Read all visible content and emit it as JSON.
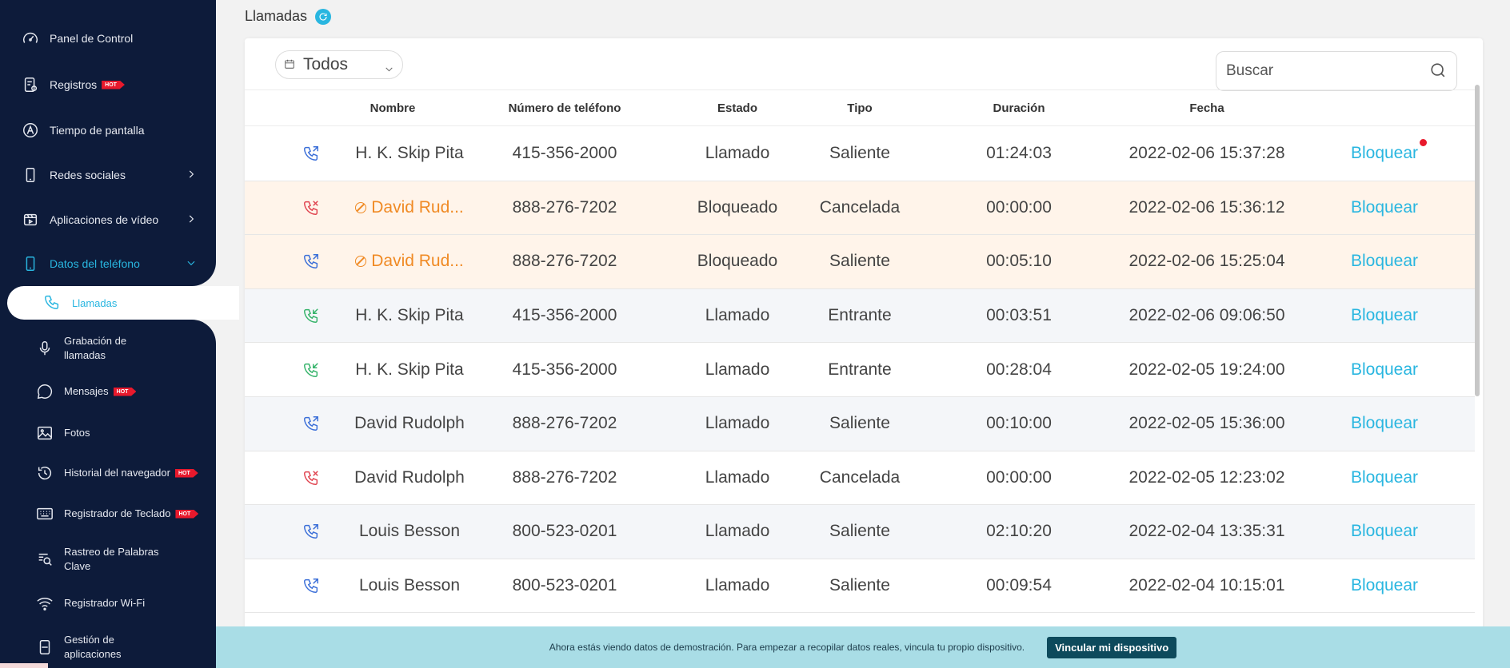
{
  "page": {
    "title": "Llamadas",
    "filter_value": "Todos",
    "search_placeholder": "Buscar"
  },
  "sidebar": {
    "hot_label": "HOT",
    "items": [
      {
        "label": "Panel de Control",
        "icon": "dashboard-icon"
      },
      {
        "label": "Registros",
        "icon": "records-icon",
        "hot": true
      },
      {
        "label": "Tiempo de pantalla",
        "icon": "screen-time-icon"
      },
      {
        "label": "Redes sociales",
        "icon": "phone-icon",
        "chevron": "right"
      },
      {
        "label": "Aplicaciones de vídeo",
        "icon": "video-icon",
        "chevron": "right"
      },
      {
        "label": "Datos del teléfono",
        "icon": "phone-icon",
        "chevron": "down",
        "active": true
      }
    ],
    "sub_items": [
      {
        "label": "Llamadas",
        "icon": "phone-call-icon",
        "active": true
      },
      {
        "label": "Grabación de llamadas",
        "icon": "microphone-icon"
      },
      {
        "label": "Mensajes",
        "icon": "chat-icon",
        "hot": true
      },
      {
        "label": "Fotos",
        "icon": "image-icon"
      },
      {
        "label": "Historial del navegador",
        "icon": "history-icon",
        "hot": true
      },
      {
        "label": "Registrador de Teclado",
        "icon": "keyboard-icon",
        "hot": true
      },
      {
        "label": "Rastreo de Palabras Clave",
        "icon": "keyword-search-icon"
      },
      {
        "label": "Registrador Wi-Fi",
        "icon": "wifi-icon"
      },
      {
        "label": "Gestión de aplicaciones",
        "icon": "app-icon"
      }
    ]
  },
  "table": {
    "headers": [
      "Nombre",
      "Número de teléfono",
      "Estado",
      "Tipo",
      "Duración",
      "Fecha"
    ],
    "action_label": "Bloquear",
    "rows": [
      {
        "name": "H. K. Skip Pita",
        "number": "415-356-2000",
        "status": "Llamado",
        "type": "Saliente",
        "duration": "01:24:03",
        "date": "2022-02-06 15:37:28",
        "direction": "outgoing",
        "blocked": false
      },
      {
        "name": "David Rud...",
        "number": "888-276-7202",
        "status": "Bloqueado",
        "type": "Cancelada",
        "duration": "00:00:00",
        "date": "2022-02-06 15:36:12",
        "direction": "cancelled",
        "blocked": true
      },
      {
        "name": "David Rud...",
        "number": "888-276-7202",
        "status": "Bloqueado",
        "type": "Saliente",
        "duration": "00:05:10",
        "date": "2022-02-06 15:25:04",
        "direction": "outgoing",
        "blocked": true
      },
      {
        "name": "H. K. Skip Pita",
        "number": "415-356-2000",
        "status": "Llamado",
        "type": "Entrante",
        "duration": "00:03:51",
        "date": "2022-02-06 09:06:50",
        "direction": "incoming",
        "blocked": false
      },
      {
        "name": "H. K. Skip Pita",
        "number": "415-356-2000",
        "status": "Llamado",
        "type": "Entrante",
        "duration": "00:28:04",
        "date": "2022-02-05 19:24:00",
        "direction": "incoming",
        "blocked": false
      },
      {
        "name": "David Rudolph",
        "number": "888-276-7202",
        "status": "Llamado",
        "type": "Saliente",
        "duration": "00:10:00",
        "date": "2022-02-05 15:36:00",
        "direction": "outgoing",
        "blocked": false
      },
      {
        "name": "David Rudolph",
        "number": "888-276-7202",
        "status": "Llamado",
        "type": "Cancelada",
        "duration": "00:00:00",
        "date": "2022-02-05 12:23:02",
        "direction": "cancelled",
        "blocked": false
      },
      {
        "name": "Louis Besson",
        "number": "800-523-0201",
        "status": "Llamado",
        "type": "Saliente",
        "duration": "02:10:20",
        "date": "2022-02-04 13:35:31",
        "direction": "outgoing",
        "blocked": false
      },
      {
        "name": "Louis Besson",
        "number": "800-523-0201",
        "status": "Llamado",
        "type": "Saliente",
        "duration": "00:09:54",
        "date": "2022-02-04 10:15:01",
        "direction": "outgoing",
        "blocked": false
      }
    ]
  },
  "banner": {
    "text": "Ahora estás viendo datos de demostración. Para empezar a recopilar datos reales, vincula tu propio dispositivo.",
    "button_label": "Vincular mi dispositivo"
  },
  "colors": {
    "sidebar_bg": "#0d1b3a",
    "accent": "#29b6e0",
    "outgoing": "#3b6fd8",
    "incoming": "#35b36a",
    "cancelled": "#e0434f",
    "blocked_text": "#f08a24",
    "hot": "#e8192c"
  }
}
